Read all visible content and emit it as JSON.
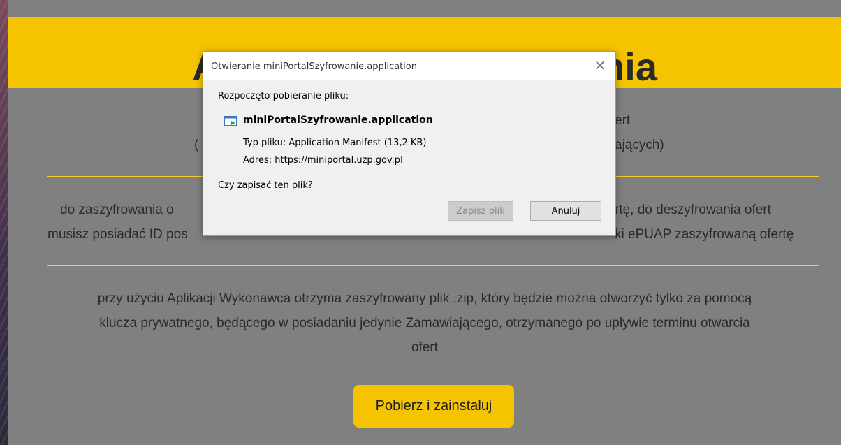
{
  "page": {
    "title": "Aplikacja do szyfrowania",
    "intro_line1": "ert",
    "intro_line2_left": "(",
    "intro_line2_right": "ających)",
    "para1_line1_left": "do zaszyfrowania o",
    "para1_line1_right": "rtę, do deszyfrowania ofert",
    "para1_line2_left": "musisz posiadać ID pos",
    "para1_line2_right": "ki ePUAP zaszyfrowaną ofertę",
    "para2_line1": "przy użyciu Aplikacji Wykonawca otrzyma zaszyfrowany plik .zip, który będzie można otworzyć tylko za pomocą",
    "para2_line2": "klucza prywatnego, będącego w posiadaniu jedynie Zamawiającego, otrzymanego po upływie terminu otwarcia",
    "para2_line3": "ofert",
    "cta_label": "Pobierz i zainstaluj"
  },
  "dialog": {
    "title": "Otwieranie miniPortalSzyfrowanie.application",
    "close_glyph": "✕",
    "started_text": "Rozpoczęto pobieranie pliku:",
    "file_name": "miniPortalSzyfrowanie.application",
    "file_type": "Typ pliku: Application Manifest (13,2 KB)",
    "address": "Adres: https://miniportal.uzp.gov.pl",
    "question": "Czy zapisać ten plik?",
    "save_label": "Zapisz plik",
    "cancel_label": "Anuluj",
    "save_disabled": true
  },
  "icons": {
    "file": "application-file-icon",
    "close": "close-icon"
  },
  "colors": {
    "accent": "#f5c400",
    "overlay": "#808080"
  }
}
